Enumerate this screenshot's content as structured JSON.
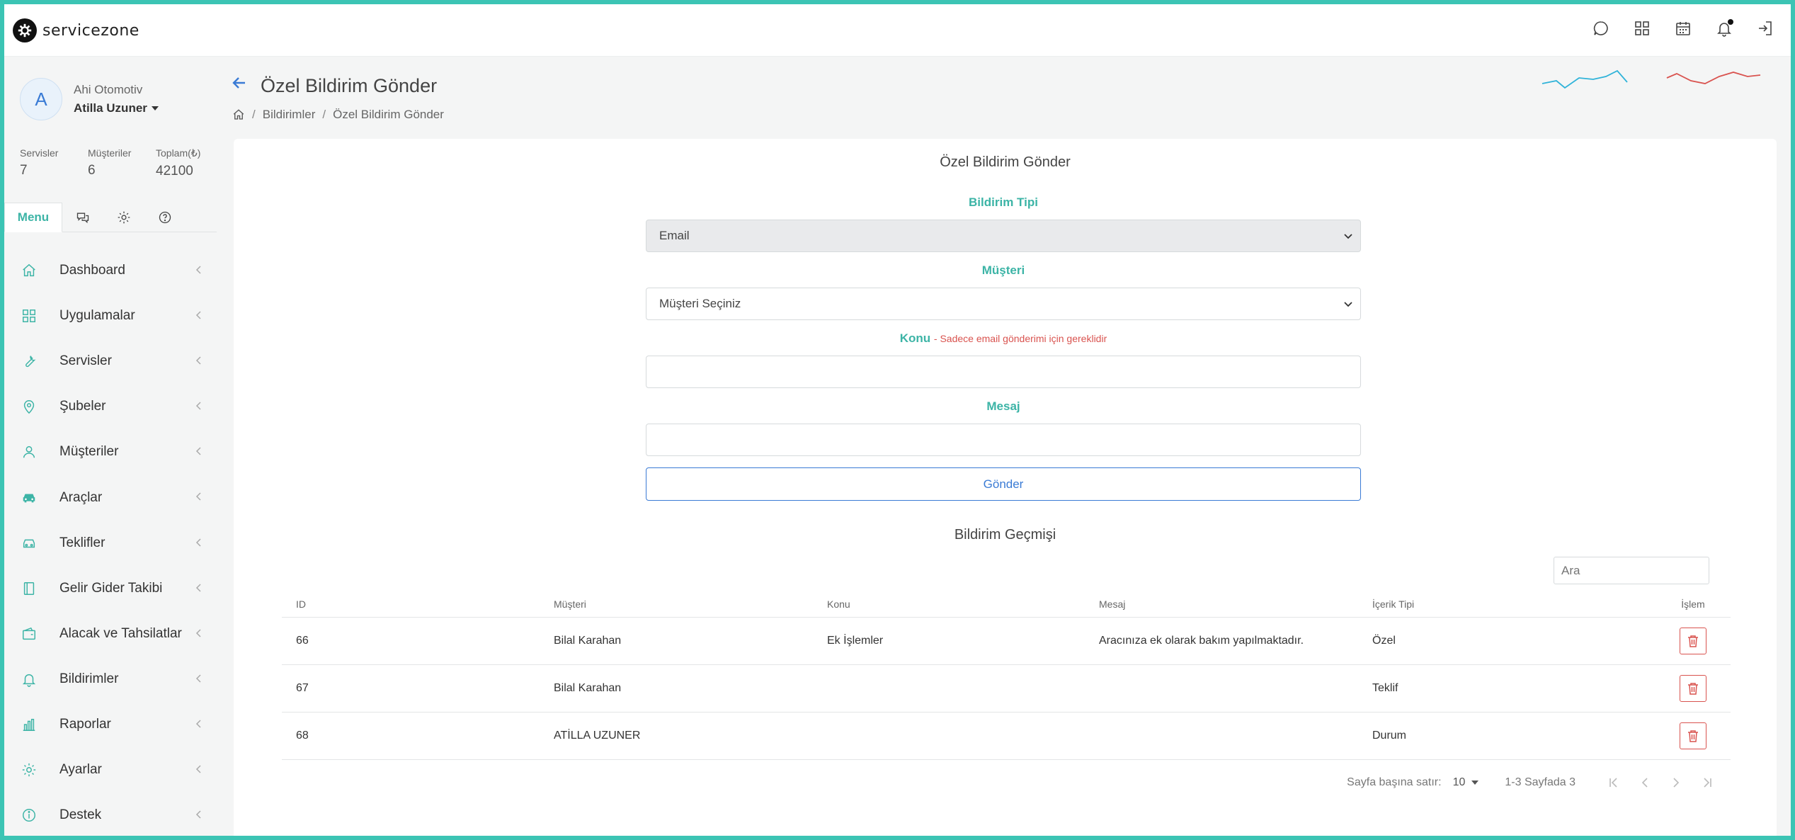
{
  "app": {
    "brand": "servicezone"
  },
  "profile": {
    "avatar_letter": "A",
    "company": "Ahi Otomotiv",
    "user": "Atilla Uzuner"
  },
  "stats": [
    {
      "label": "Servisler",
      "value": "7"
    },
    {
      "label": "Müşteriler",
      "value": "6"
    },
    {
      "label": "Toplam(₺)",
      "value": "42100"
    }
  ],
  "sidebar_tabs": {
    "menu_label": "Menu"
  },
  "menu": [
    {
      "label": "Dashboard",
      "icon": "home-icon"
    },
    {
      "label": "Uygulamalar",
      "icon": "apps-grid-icon"
    },
    {
      "label": "Servisler",
      "icon": "wrench-icon"
    },
    {
      "label": "Şubeler",
      "icon": "location-pin-icon"
    },
    {
      "label": "Müşteriler",
      "icon": "customer-icon"
    },
    {
      "label": "Araçlar",
      "icon": "car-icon"
    },
    {
      "label": "Teklifler",
      "icon": "offer-car-icon"
    },
    {
      "label": "Gelir Gider Takibi",
      "icon": "ledger-icon"
    },
    {
      "label": "Alacak ve Tahsilatlar",
      "icon": "wallet-icon"
    },
    {
      "label": "Bildirimler",
      "icon": "bell-icon"
    },
    {
      "label": "Raporlar",
      "icon": "bar-chart-icon"
    },
    {
      "label": "Ayarlar",
      "icon": "gear-icon"
    },
    {
      "label": "Destek",
      "icon": "info-icon"
    }
  ],
  "header": {
    "title": "Özel Bildirim Gönder",
    "breadcrumb": [
      "Bildirimler",
      "Özel Bildirim Gönder"
    ]
  },
  "form": {
    "title": "Özel Bildirim Gönder",
    "type_label": "Bildirim Tipi",
    "type_value": "Email",
    "customer_label": "Müşteri",
    "customer_value": "Müşteri Seçiniz",
    "subject_label": "Konu",
    "subject_note": "- Sadece email gönderimi için gereklidir",
    "subject_value": "",
    "message_label": "Mesaj",
    "message_value": "",
    "submit_label": "Gönder"
  },
  "history": {
    "title": "Bildirim Geçmişi",
    "search_placeholder": "Ara",
    "columns": [
      "ID",
      "Müşteri",
      "Konu",
      "Mesaj",
      "İçerik Tipi",
      "İşlem"
    ],
    "rows": [
      {
        "id": "66",
        "customer": "Bilal Karahan",
        "subject": "Ek İşlemler",
        "message": "Aracınıza ek olarak bakım yapılmaktadır.",
        "content_type": "Özel"
      },
      {
        "id": "67",
        "customer": "Bilal Karahan",
        "subject": "",
        "message": "",
        "content_type": "Teklif"
      },
      {
        "id": "68",
        "customer": "ATİLLA UZUNER",
        "subject": "",
        "message": "",
        "content_type": "Durum"
      }
    ],
    "pagination": {
      "rows_per_page_label": "Sayfa başına satır:",
      "rows_per_page": "10",
      "range": "1-3 Sayfada 3"
    }
  },
  "colors": {
    "accent": "#3cb4a6",
    "primary": "#3a7bd5",
    "danger": "#d9534f",
    "frame": "#3cc4b4"
  }
}
